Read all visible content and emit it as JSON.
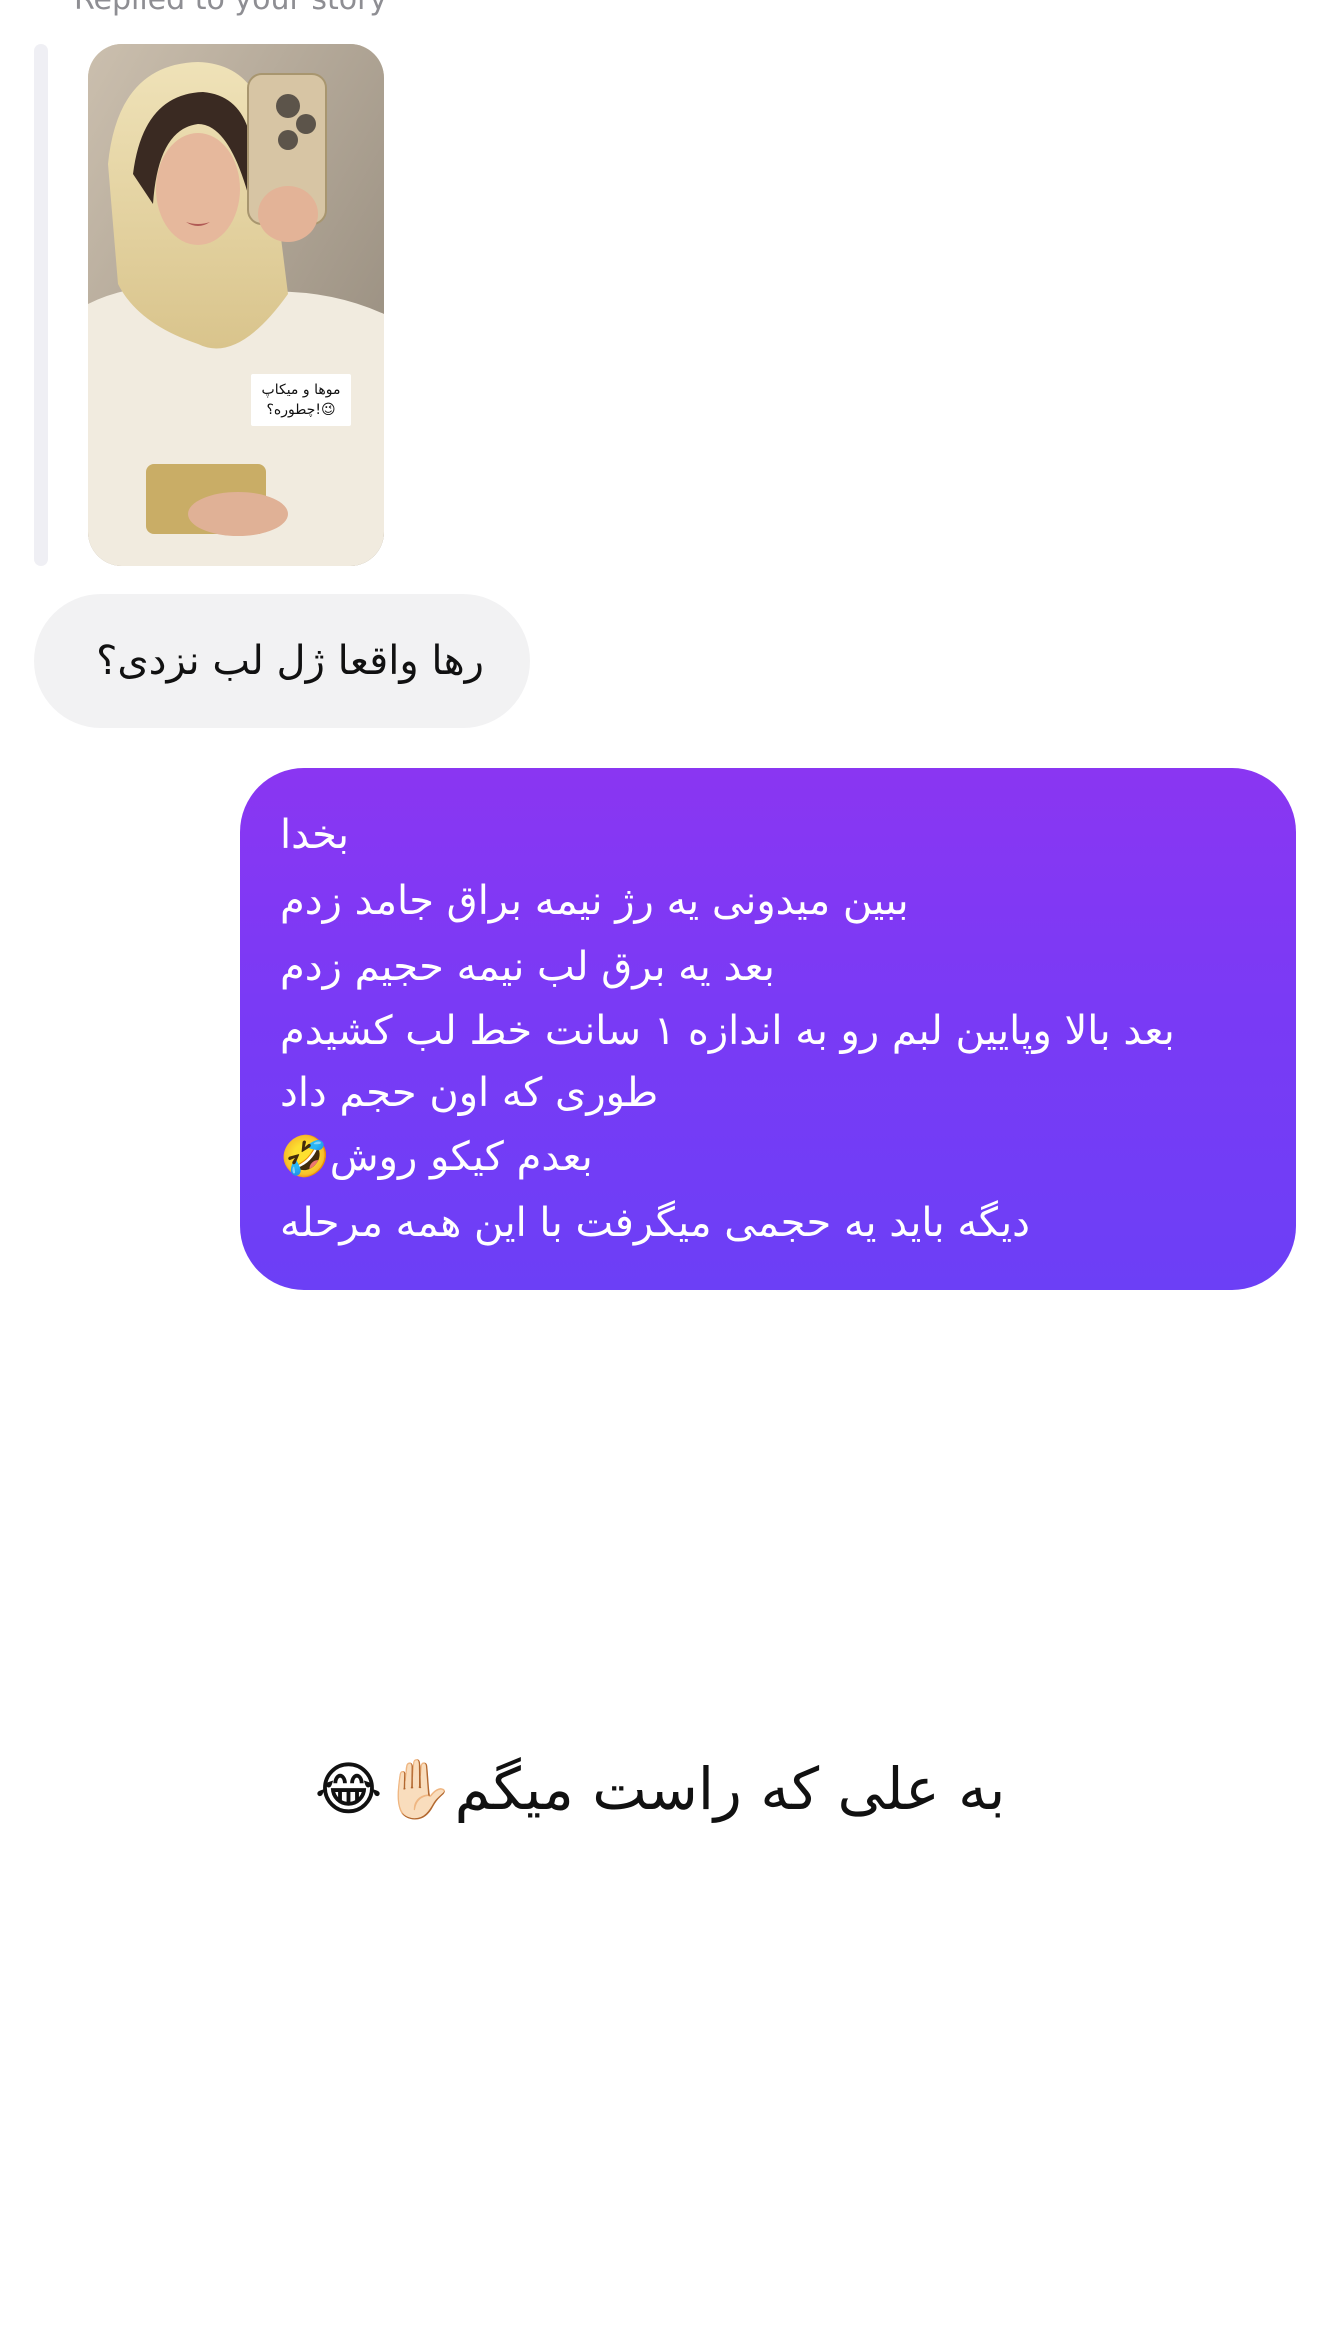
{
  "reply_context": {
    "label": "Replied to your story",
    "story_sticker_line1": "موها و میکاپ",
    "story_sticker_line2": "چطوره؟!😉"
  },
  "messages": [
    {
      "sender": "other",
      "text": "رها واقعا ژل لب نزدی؟"
    },
    {
      "sender": "me",
      "lines": [
        "بخدا",
        "ببین میدونی یه رژ  نیمه براق جامد زدم",
        "بعد یه برق لب نیمه حجیم زدم",
        "بعد بالا وپایین لبم رو به اندازه ۱ سانت خط لب کشیدم",
        "طوری که اون حجم داد",
        "بعدم کیکو روش🤣",
        "دیگه باید یه حجمی میگرفت با این همه مرحله"
      ]
    }
  ],
  "caption": "به علی که راست میگم✋🏻😂",
  "colors": {
    "sent_bubble_top": "#8a36f2",
    "sent_bubble_bottom": "#6c3ff6",
    "received_bubble": "#f2f2f3",
    "reply_label": "#8e8e93"
  }
}
